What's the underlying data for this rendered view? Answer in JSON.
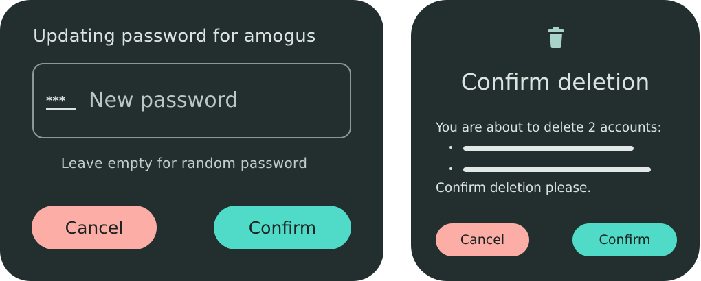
{
  "password_dialog": {
    "title": "Updating password for amogus",
    "field": {
      "icon": "password-icon",
      "value": "",
      "placeholder": "New password"
    },
    "hint": "Leave empty for random password",
    "cancel_label": "Cancel",
    "confirm_label": "Confirm"
  },
  "delete_dialog": {
    "icon": "trash-icon",
    "title": "Confirm deletion",
    "body": "You are about to delete 2 accounts:",
    "accounts": [
      "",
      ""
    ],
    "footer": "Confirm deletion please.",
    "cancel_label": "Cancel",
    "confirm_label": "Confirm"
  },
  "colors": {
    "dialog_background": "#222f2e",
    "cancel_button": "#fcada5",
    "confirm_button": "#4fdbc8",
    "text": "#dbe3e1",
    "field_outline": "#8b9896"
  }
}
